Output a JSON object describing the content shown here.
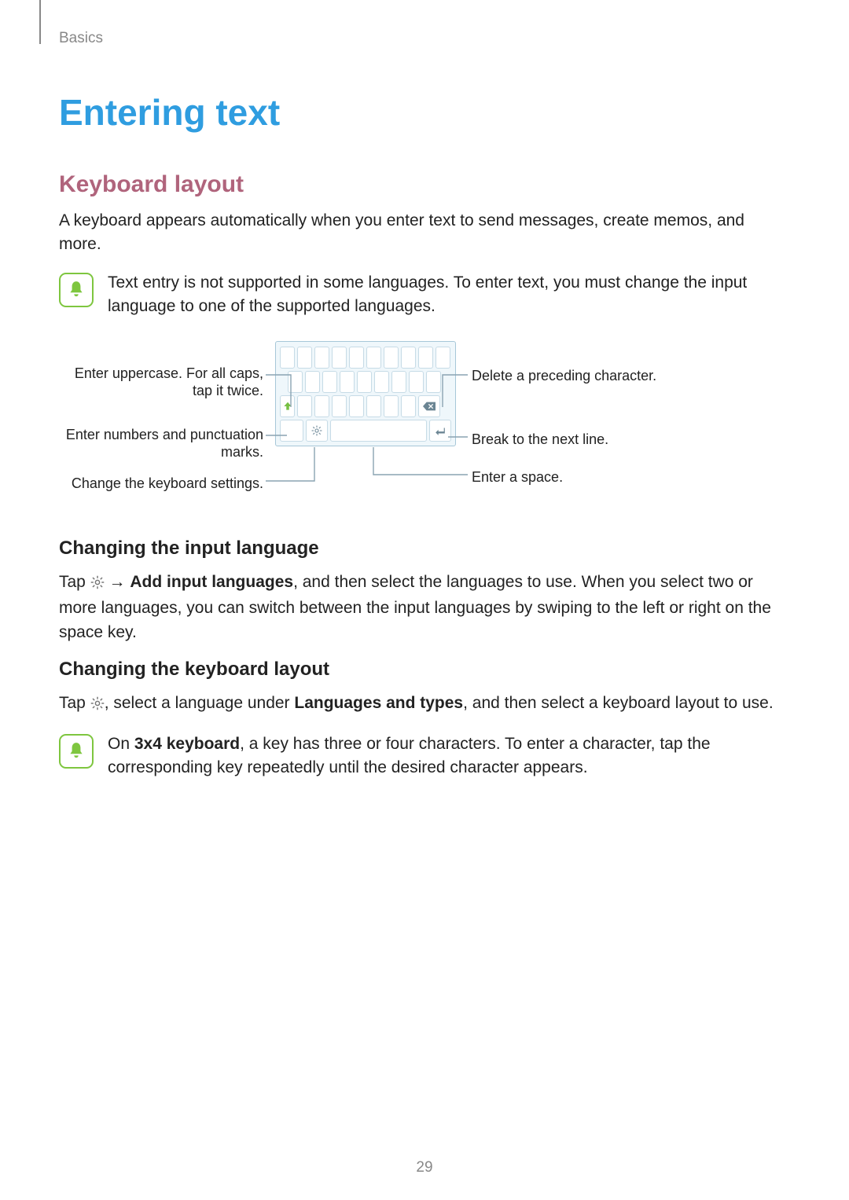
{
  "header": {
    "breadcrumb": "Basics"
  },
  "title": "Entering text",
  "section1": {
    "heading": "Keyboard layout",
    "intro": "A keyboard appears automatically when you enter text to send messages, create memos, and more.",
    "note": "Text entry is not supported in some languages. To enter text, you must change the input language to one of the supported languages."
  },
  "diagram": {
    "labels": {
      "uppercase": "Enter uppercase. For all caps, tap it twice.",
      "numbers": "Enter numbers and punctuation marks.",
      "settings": "Change the keyboard settings.",
      "delete": "Delete a preceding character.",
      "nextline": "Break to the next line.",
      "space": "Enter a space."
    }
  },
  "section2": {
    "heading": "Changing the input language",
    "para_pre": "Tap ",
    "para_arrow": " → ",
    "para_bold": "Add input languages",
    "para_post": ", and then select the languages to use. When you select two or more languages, you can switch between the input languages by swiping to the left or right on the space key."
  },
  "section3": {
    "heading": "Changing the keyboard layout",
    "para_pre": "Tap ",
    "para_mid": ", select a language under ",
    "para_bold": "Languages and types",
    "para_post": ", and then select a keyboard layout to use.",
    "note_pre": "On ",
    "note_bold": "3x4 keyboard",
    "note_post": ", a key has three or four characters. To enter a character, tap the corresponding key repeatedly until the desired character appears."
  },
  "page_number": "29"
}
